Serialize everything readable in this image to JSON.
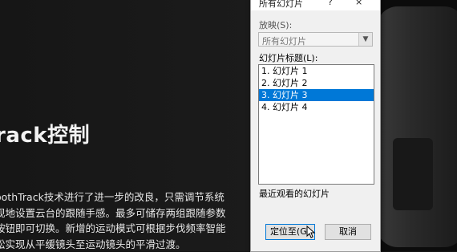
{
  "slide": {
    "title": "rack控制",
    "body_lines": [
      "oothTrack技术进行了进一步的改良，只需调节系统",
      "现地设置云台的跟随手感。最多可储存两组跟随参数",
      "按钮即可切换。新增的运动模式可根据步伐频率智能",
      "松实现从平缓镜头至运动镜头的平滑过渡。"
    ]
  },
  "dialog": {
    "title": "所有幻灯片",
    "help": "?",
    "close": "×",
    "show_label": "放映(S):",
    "show_value": "所有幻灯片",
    "list_label": "幻灯片标题(L):",
    "items": [
      "1. 幻灯片 1",
      "2. 幻灯片 2",
      "3. 幻灯片 3",
      "4. 幻灯片 4"
    ],
    "selected_index": 2,
    "recent_label": "最近观看的幻灯片",
    "goto_button": "定位至(G)",
    "cancel_button": "取消"
  },
  "colors": {
    "selection": "#0078d7",
    "dialog_bg": "#f0f0f0"
  }
}
